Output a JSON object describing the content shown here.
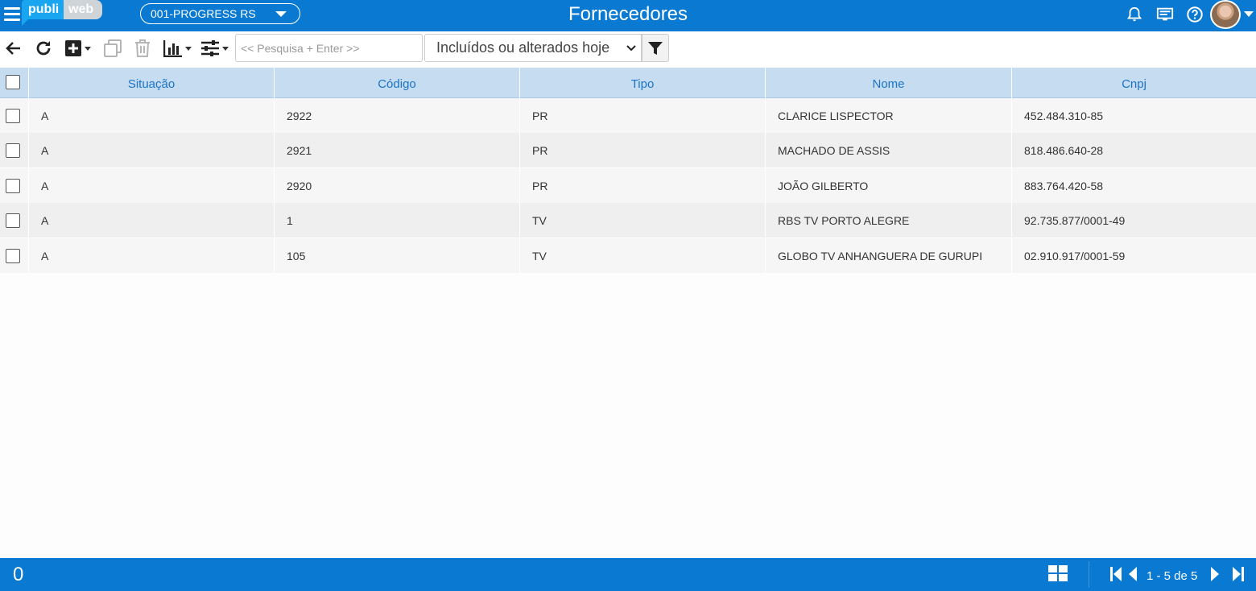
{
  "header": {
    "logo_left": "publi",
    "logo_right": "web",
    "company": "001-PROGRESS RS",
    "title": "Fornecedores"
  },
  "toolbar": {
    "search_placeholder": "<< Pesquisa + Enter >>",
    "filter_value": "Incluídos ou alterados hoje"
  },
  "table": {
    "columns": [
      "Situação",
      "Código",
      "Tipo",
      "Nome",
      "Cnpj"
    ],
    "rows": [
      {
        "situacao": "A",
        "codigo": "2922",
        "tipo": "PR",
        "nome": "CLARICE LISPECTOR",
        "cnpj": "452.484.310-85"
      },
      {
        "situacao": "A",
        "codigo": "2921",
        "tipo": "PR",
        "nome": "MACHADO DE ASSIS",
        "cnpj": "818.486.640-28"
      },
      {
        "situacao": "A",
        "codigo": "2920",
        "tipo": "PR",
        "nome": "JOÃO GILBERTO",
        "cnpj": "883.764.420-58"
      },
      {
        "situacao": "A",
        "codigo": "1",
        "tipo": "TV",
        "nome": "RBS TV PORTO ALEGRE",
        "cnpj": "92.735.877/0001-49"
      },
      {
        "situacao": "A",
        "codigo": "105",
        "tipo": "TV",
        "nome": "GLOBO TV ANHANGUERA DE GURUPI",
        "cnpj": "02.910.917/0001-59"
      }
    ]
  },
  "footer": {
    "selected_count": "0",
    "page_info": "1 - 5 de 5"
  },
  "colors": {
    "primary": "#0a79d1",
    "header_bg": "#c6dcf0",
    "header_text": "#1b74c7"
  }
}
